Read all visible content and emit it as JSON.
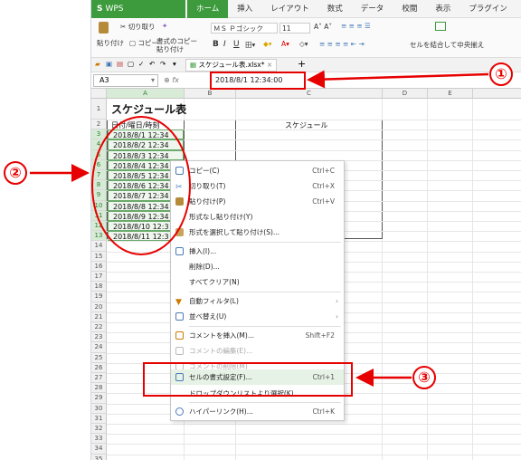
{
  "app": {
    "name": "WPS Spreadsheets",
    "tabs": [
      "ホーム",
      "挿入",
      "レイアウト",
      "数式",
      "データ",
      "校閲",
      "表示",
      "プラグイン"
    ],
    "active_tab": "ホーム"
  },
  "ribbon": {
    "cut": "切り取り",
    "paste": "貼り付け",
    "copy": "コピー",
    "format_copy": "書式のコピー",
    "format_paste": "貼り付け",
    "font_name": "ＭＳ Ｐゴシック",
    "font_size": "11",
    "merge_center": "セルを結合して中央揃え",
    "bold": "B",
    "italic": "I",
    "underline": "U"
  },
  "quickbar": {
    "doc_tab": "スケジュール表.xlsx*",
    "add": "+"
  },
  "formulabar": {
    "cell_ref": "A3",
    "fx": "fx",
    "value": "2018/8/1 12:34:00"
  },
  "columns": [
    "A",
    "B",
    "C",
    "D",
    "E"
  ],
  "rows": [
    "1",
    "2",
    "3",
    "4",
    "5",
    "6",
    "7",
    "8",
    "9",
    "10",
    "11",
    "12",
    "13",
    "14",
    "15",
    "16",
    "17",
    "18",
    "19",
    "20",
    "21",
    "22",
    "23",
    "24",
    "25",
    "26",
    "27",
    "28",
    "29",
    "30",
    "31",
    "32",
    "33",
    "34",
    "35"
  ],
  "sheet": {
    "title": "スケジュール表",
    "header_a": "日付/曜日/時刻",
    "header_c": "スケジュール",
    "dates": [
      "2018/8/1 12:34",
      "2018/8/2 12:34",
      "2018/8/3 12:34",
      "2018/8/4 12:34",
      "2018/8/5 12:34",
      "2018/8/6 12:34",
      "2018/8/7 12:34",
      "2018/8/8 12:34",
      "2018/8/9 12:34",
      "2018/8/10 12:3",
      "2018/8/11 12:3"
    ]
  },
  "context_menu": {
    "copy": {
      "label": "コピー(C)",
      "shortcut": "Ctrl+C"
    },
    "cut": {
      "label": "切り取り(T)",
      "shortcut": "Ctrl+X"
    },
    "paste": {
      "label": "貼り付け(P)",
      "shortcut": "Ctrl+V"
    },
    "paste_plain": {
      "label": "形式なし貼り付け(Y)"
    },
    "paste_special": {
      "label": "形式を選択して貼り付け(S)..."
    },
    "insert": {
      "label": "挿入(I)..."
    },
    "delete": {
      "label": "削除(D)..."
    },
    "clear_all": {
      "label": "すべてクリア(N)"
    },
    "autofilter": {
      "label": "自動フィルタ(L)"
    },
    "sort": {
      "label": "並べ替え(U)"
    },
    "insert_comment": {
      "label": "コメントを挿入(M)...",
      "shortcut": "Shift+F2"
    },
    "edit_comment": {
      "label": "コメントの編集(E)..."
    },
    "delete_comment": {
      "label": "コメントの削除(M)"
    },
    "format_cells": {
      "label": "セルの書式設定(F)...",
      "shortcut": "Ctrl+1"
    },
    "dropdown_list": {
      "label": "ドロップダウンリストより選択(K)"
    },
    "hyperlink": {
      "label": "ハイパーリンク(H)...",
      "shortcut": "Ctrl+K"
    }
  },
  "callouts": [
    "①",
    "②",
    "③"
  ],
  "colors": {
    "annotation_red": "#e60000",
    "wps_green": "#3d9b3d"
  }
}
